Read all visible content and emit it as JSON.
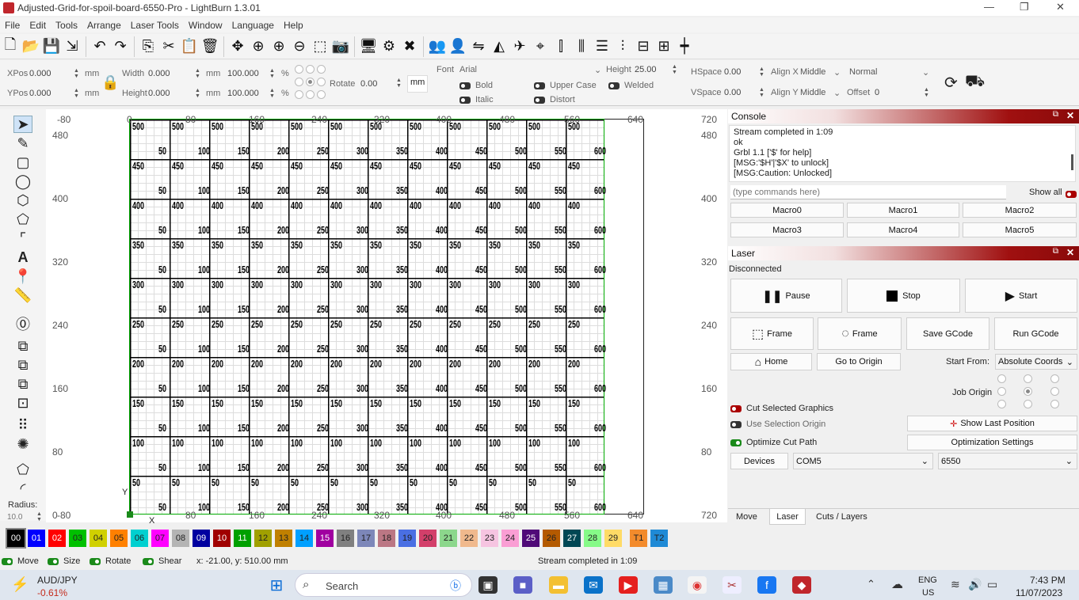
{
  "window": {
    "title": "Adjusted-Grid-for-spoil-board-6550-Pro - LightBurn 1.3.01",
    "minimize": "—",
    "maximize": "❐",
    "close": "✕"
  },
  "menu": [
    "File",
    "Edit",
    "Tools",
    "Arrange",
    "Laser Tools",
    "Window",
    "Language",
    "Help"
  ],
  "toolbar2": {
    "xpos_label": "XPos",
    "xpos": "0.000",
    "ypos_label": "YPos",
    "ypos": "0.000",
    "mm": "mm",
    "width_label": "Width",
    "width": "0.000",
    "height_label": "Height",
    "height": "0.000",
    "scale_w": "100.000",
    "scale_h": "100.000",
    "pct": "%",
    "rotate_label": "Rotate",
    "rotate": "0.00",
    "mm_btn": "mm",
    "font_label": "Font",
    "font": "Arial",
    "height2_label": "Height",
    "height2": "25.00",
    "hspace_label": "HSpace",
    "hspace": "0.00",
    "vspace_label": "VSpace",
    "vspace": "0.00",
    "alignx_label": "Align X",
    "alignx": "Middle",
    "aligny_label": "Align Y",
    "aligny": "Middle",
    "normal": "Normal",
    "offset_label": "Offset",
    "offset": "0",
    "bold": "Bold",
    "italic": "Italic",
    "upper": "Upper Case",
    "distort": "Distort",
    "welded": "Welded"
  },
  "rulers": {
    "top": [
      "-80",
      "0",
      "80",
      "160",
      "240",
      "320",
      "400",
      "480",
      "560",
      "640"
    ],
    "left": [
      "480",
      "400",
      "320",
      "240",
      "160",
      "80",
      "0"
    ],
    "right": [
      "720",
      "480",
      "400",
      "320",
      "240",
      "160",
      "80",
      "720"
    ],
    "bottom": [
      "-80",
      "80",
      "160",
      "240",
      "320",
      "400",
      "480",
      "560",
      "640"
    ]
  },
  "grid": {
    "rows": [
      "500",
      "450",
      "400",
      "350",
      "300",
      "250",
      "200",
      "150",
      "100",
      "50"
    ],
    "cols": [
      "50",
      "100",
      "150",
      "200",
      "250",
      "300",
      "350",
      "400",
      "450",
      "500",
      "550",
      "600"
    ]
  },
  "axis": {
    "x": "X",
    "y": "Y"
  },
  "left_tools": {
    "radius_label": "Radius:",
    "radius": "10.0"
  },
  "console": {
    "title": "Console",
    "lines": [
      "Stream completed in 1:09",
      "ok",
      "Grbl 1.1 ['$' for help]",
      "[MSG:'$H'|'$X' to unlock]",
      "[MSG:Caution: Unlocked]"
    ],
    "placeholder": "(type commands here)",
    "show_all": "Show all",
    "macros": [
      "Macro0",
      "Macro1",
      "Macro2",
      "Macro3",
      "Macro4",
      "Macro5"
    ]
  },
  "laser": {
    "title": "Laser",
    "status": "Disconnected",
    "pause": "Pause",
    "stop": "Stop",
    "start": "Start",
    "frame1": "Frame",
    "frame2": "Frame",
    "save_gcode": "Save GCode",
    "run_gcode": "Run GCode",
    "home": "Home",
    "go_origin": "Go to Origin",
    "start_from_label": "Start From:",
    "start_from": "Absolute Coords",
    "job_origin": "Job Origin",
    "cut_selected": "Cut Selected Graphics",
    "use_selection": "Use Selection Origin",
    "optimize": "Optimize Cut Path",
    "show_last": "Show Last Position",
    "opt_settings": "Optimization Settings",
    "devices": "Devices",
    "port": "COM5",
    "device": "6550"
  },
  "bottom_tabs": [
    "Move",
    "Laser",
    "Cuts / Layers"
  ],
  "palette": [
    [
      "00",
      "#000000"
    ],
    [
      "01",
      "#0000ff"
    ],
    [
      "02",
      "#ff0000"
    ],
    [
      "03",
      "#00c000"
    ],
    [
      "04",
      "#d0d000"
    ],
    [
      "05",
      "#ff8000"
    ],
    [
      "06",
      "#00d0d0"
    ],
    [
      "07",
      "#ff00ff"
    ],
    [
      "08",
      "#b4b4b4"
    ],
    [
      "09",
      "#0000a0"
    ],
    [
      "10",
      "#a00000"
    ],
    [
      "11",
      "#00a000"
    ],
    [
      "12",
      "#a0a000"
    ],
    [
      "13",
      "#c08000"
    ],
    [
      "14",
      "#00a0ff"
    ],
    [
      "15",
      "#a000a0"
    ],
    [
      "16",
      "#808080"
    ],
    [
      "17",
      "#7d87b9"
    ],
    [
      "18",
      "#bb7784"
    ],
    [
      "19",
      "#4a6fe3"
    ],
    [
      "20",
      "#d33f6a"
    ],
    [
      "21",
      "#8cd78c"
    ],
    [
      "22",
      "#f0b98d"
    ],
    [
      "23",
      "#f6c4e1"
    ],
    [
      "24",
      "#fa9ed4"
    ],
    [
      "25",
      "#500a78"
    ],
    [
      "26",
      "#b45a00"
    ],
    [
      "27",
      "#004754"
    ],
    [
      "28",
      "#86fa88"
    ],
    [
      "29",
      "#ffdb66"
    ],
    [
      "T1",
      "#f38b2c"
    ],
    [
      "T2",
      "#1f8ad6"
    ]
  ],
  "status": {
    "move": "Move",
    "size": "Size",
    "rotate": "Rotate",
    "shear": "Shear",
    "coords": "x: -21.00, y: 510.00 mm",
    "message": "Stream completed in 1:09"
  },
  "taskbar": {
    "ticker": "AUD/JPY",
    "change": "-0.61%",
    "search": "Search",
    "lang1": "ENG",
    "lang2": "US",
    "time": "7:43 PM",
    "date": "11/07/2023"
  }
}
